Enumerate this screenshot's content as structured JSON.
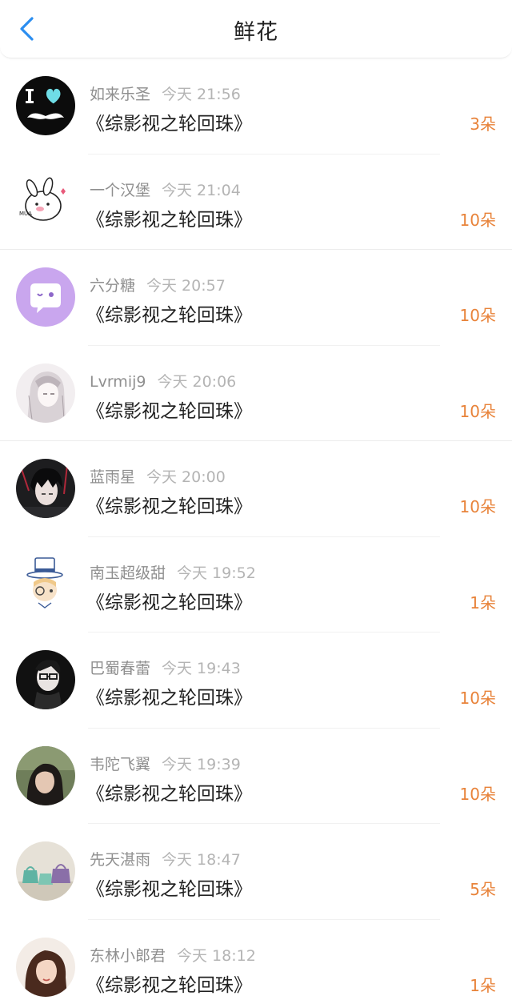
{
  "header": {
    "title": "鲜花",
    "back_icon": "chevron-left-icon",
    "accent_color": "#2b8ef0"
  },
  "count_color": "#e8833a",
  "items": [
    {
      "name": "如来乐圣",
      "time": "今天 21:56",
      "book": "《综影视之轮回珠》",
      "count": "3朵",
      "avatar": "i-love-mustache-avatar"
    },
    {
      "name": "一个汉堡",
      "time": "今天 21:04",
      "book": "《综影视之轮回珠》",
      "count": "10朵",
      "avatar": "bunny-cartoon-avatar"
    },
    {
      "name": "六分糖",
      "time": "今天 20:57",
      "book": "《综影视之轮回珠》",
      "count": "10朵",
      "avatar": "purple-chat-bubble-avatar"
    },
    {
      "name": "Lvrmij9",
      "time": "今天 20:06",
      "book": "《综影视之轮回珠》",
      "count": "10朵",
      "avatar": "anime-girl-sketch-avatar"
    },
    {
      "name": "蓝雨星",
      "time": "今天 20:00",
      "book": "《综影视之轮回珠》",
      "count": "10朵",
      "avatar": "dark-anime-boy-avatar"
    },
    {
      "name": "南玉超级甜",
      "time": "今天 19:52",
      "book": "《综影视之轮回珠》",
      "count": "1朵",
      "avatar": "detective-cartoon-avatar"
    },
    {
      "name": "巴蜀春蕾",
      "time": "今天 19:43",
      "book": "《综影视之轮回珠》",
      "count": "10朵",
      "avatar": "glasses-boy-avatar"
    },
    {
      "name": "韦陀飞翼",
      "time": "今天 19:39",
      "book": "《综影视之轮回珠》",
      "count": "10朵",
      "avatar": "girl-photo-avatar"
    },
    {
      "name": "先天湛雨",
      "time": "今天 18:47",
      "book": "《综影视之轮回珠》",
      "count": "5朵",
      "avatar": "handbags-photo-avatar"
    },
    {
      "name": "东林小郎君",
      "time": "今天 18:12",
      "book": "《综影视之轮回珠》",
      "count": "1朵",
      "avatar": "woman-portrait-avatar"
    }
  ]
}
